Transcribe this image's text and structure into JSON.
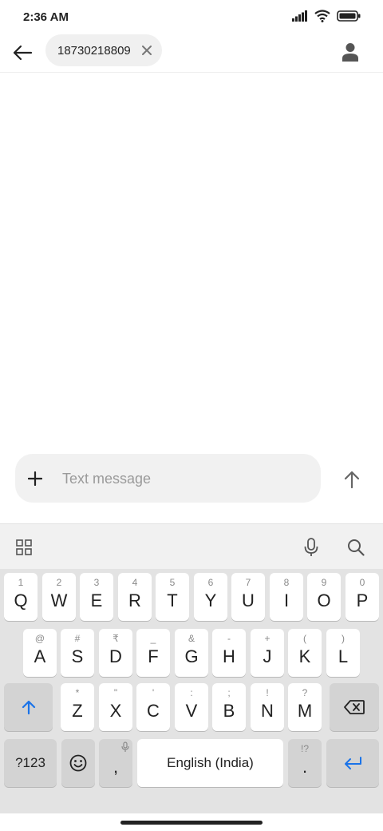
{
  "status_bar": {
    "time": "2:36 AM"
  },
  "header": {
    "recipient": "18730218809"
  },
  "compose": {
    "placeholder": "Text message"
  },
  "keyboard": {
    "row1": [
      {
        "key": "Q",
        "hint": "1"
      },
      {
        "key": "W",
        "hint": "2"
      },
      {
        "key": "E",
        "hint": "3"
      },
      {
        "key": "R",
        "hint": "4"
      },
      {
        "key": "T",
        "hint": "5"
      },
      {
        "key": "Y",
        "hint": "6"
      },
      {
        "key": "U",
        "hint": "7"
      },
      {
        "key": "I",
        "hint": "8"
      },
      {
        "key": "O",
        "hint": "9"
      },
      {
        "key": "P",
        "hint": "0"
      }
    ],
    "row2": [
      {
        "key": "A",
        "hint": "@"
      },
      {
        "key": "S",
        "hint": "#"
      },
      {
        "key": "D",
        "hint": "₹"
      },
      {
        "key": "F",
        "hint": "_"
      },
      {
        "key": "G",
        "hint": "&"
      },
      {
        "key": "H",
        "hint": "-"
      },
      {
        "key": "J",
        "hint": "+"
      },
      {
        "key": "K",
        "hint": "("
      },
      {
        "key": "L",
        "hint": ")"
      }
    ],
    "row3": [
      {
        "key": "Z",
        "hint": "*"
      },
      {
        "key": "X",
        "hint": "\""
      },
      {
        "key": "C",
        "hint": "'"
      },
      {
        "key": "V",
        "hint": ":"
      },
      {
        "key": "B",
        "hint": ";"
      },
      {
        "key": "N",
        "hint": "!"
      },
      {
        "key": "M",
        "hint": "?"
      }
    ],
    "symbols_label": "?123",
    "comma": ",",
    "space_label": "English (India)",
    "period": ".",
    "period_hint": "!?"
  }
}
